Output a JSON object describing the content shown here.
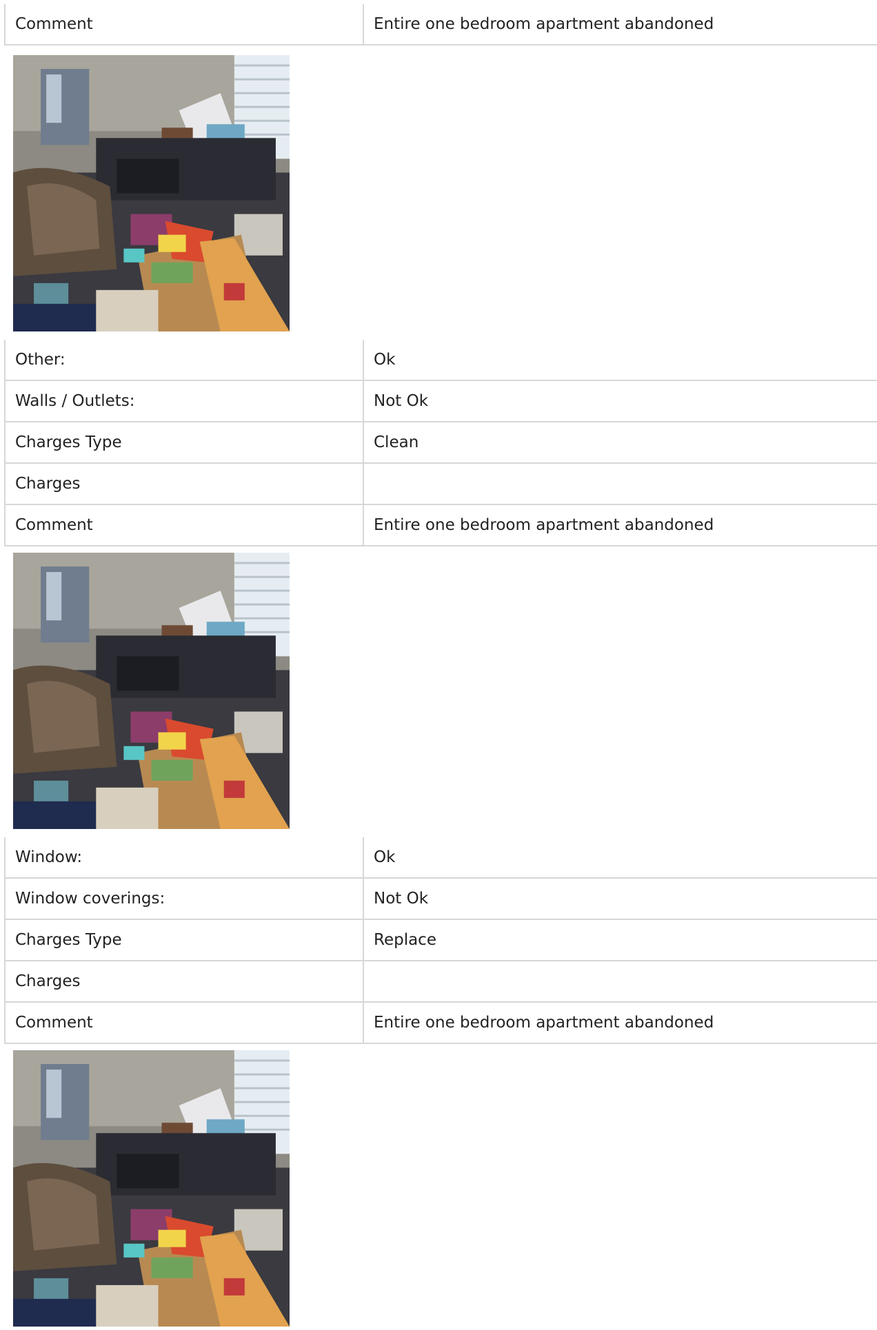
{
  "sections": [
    {
      "rows": [
        {
          "label": "Comment",
          "value": "Entire one bedroom apartment abandoned"
        }
      ]
    },
    {
      "rows": [
        {
          "label": "Other:",
          "value": "Ok"
        },
        {
          "label": "Walls / Outlets:",
          "value": "Not Ok"
        },
        {
          "label": "Charges Type",
          "value": "Clean"
        },
        {
          "label": "Charges",
          "value": ""
        },
        {
          "label": "Comment",
          "value": "Entire one bedroom apartment abandoned"
        }
      ]
    },
    {
      "rows": [
        {
          "label": "Window:",
          "value": "Ok"
        },
        {
          "label": "Window coverings:",
          "value": "Not Ok"
        },
        {
          "label": "Charges Type",
          "value": "Replace"
        },
        {
          "label": "Charges",
          "value": ""
        },
        {
          "label": "Comment",
          "value": "Entire one bedroom apartment abandoned"
        }
      ]
    }
  ],
  "photos": [
    {
      "icon": "room-photo"
    },
    {
      "icon": "room-photo"
    },
    {
      "icon": "room-photo"
    }
  ],
  "colors": {
    "border": "#d7d7d7",
    "text": "#222222"
  }
}
